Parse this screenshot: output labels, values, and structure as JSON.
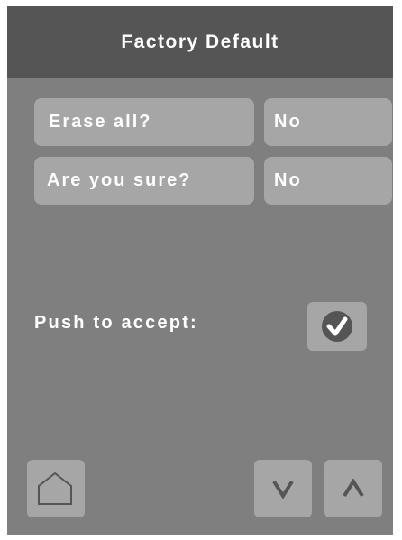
{
  "header": {
    "title": "Factory Default"
  },
  "settings": [
    {
      "label": "Erase all?",
      "value": "No"
    },
    {
      "label": "Are you sure?",
      "value": "No"
    }
  ],
  "accept": {
    "label": "Push to accept:"
  },
  "nav": {
    "down_label": "V",
    "up_label": "Λ"
  },
  "icons": {
    "home": "home-icon",
    "accept": "checkmark-circle-icon"
  },
  "colors": {
    "background": "#7f7f7f",
    "header": "#555555",
    "control": "#a6a6a6",
    "checkmark_circle": "#555555",
    "text": "#ffffff"
  }
}
